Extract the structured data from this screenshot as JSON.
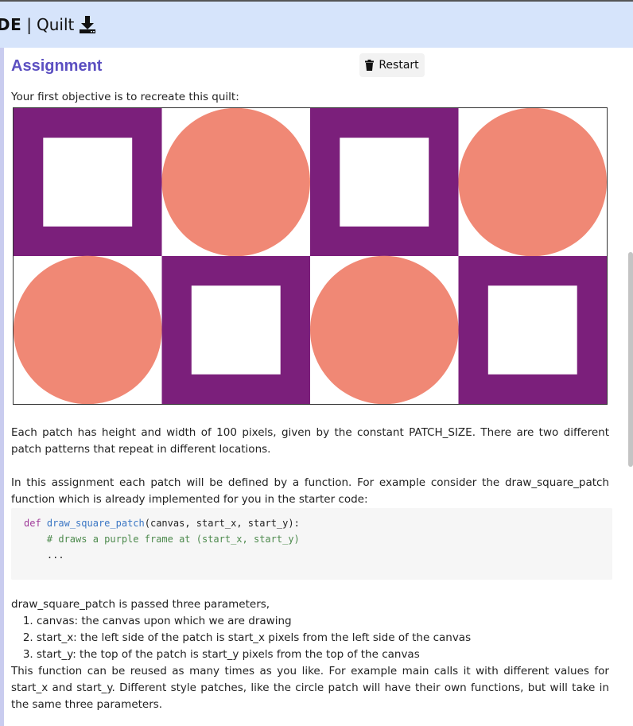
{
  "header": {
    "prefix": "DE",
    "separator": "|",
    "title": "Quilt",
    "download_icon": "download-icon"
  },
  "assignment": {
    "title": "Assignment",
    "restart_label": "Restart",
    "restart_icon": "trash-icon",
    "intro": "Your first objective is to recreate this quilt:",
    "quilt": {
      "patterns": [
        [
          "square",
          "circle",
          "square",
          "circle"
        ],
        [
          "circle",
          "square",
          "circle",
          "square"
        ]
      ],
      "colors": {
        "purple": "#7b1f7b",
        "coral": "#f08875",
        "background": "#ffffff"
      }
    },
    "para1": "Each patch has height and width of 100 pixels, given by the constant PATCH_SIZE. There are two different patch patterns that repeat in different locations.",
    "para2": "In this assignment each patch will be defined by a function. For example consider the draw_square_patch function which is already implemented for you in the starter code:",
    "code": {
      "line1_kw": "def",
      "line1_fn": "draw_square_patch",
      "line1_args": "(canvas, start_x, start_y):",
      "line2": "    # draws a purple frame at (start_x, start_y)",
      "line3": "    ..."
    },
    "para3_intro": "draw_square_patch is passed three parameters,",
    "params": [
      "canvas: the canvas upon which we are drawing",
      "start_x: the left side of the patch is start_x pixels from the left side of the canvas",
      "start_y: the top of the patch is start_y pixels from the top of the canvas"
    ],
    "para4": "This function can be reused as many times as you like. For example main calls it with different values for start_x and start_y. Different style patches, like the circle patch will have their own functions, but will take in the same three parameters."
  }
}
